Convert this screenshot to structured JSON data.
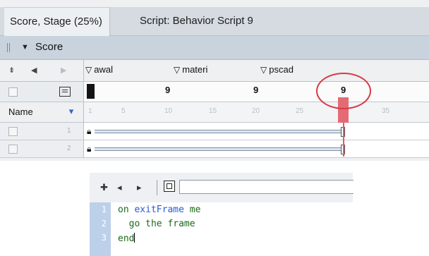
{
  "tabs": [
    {
      "label": "Score, Stage (25%)"
    },
    {
      "label": "Script: Behavior Script 9"
    }
  ],
  "score_panel": {
    "title": "Score",
    "markers": [
      {
        "label": "awal"
      },
      {
        "label": "materi"
      },
      {
        "label": "pscad"
      }
    ],
    "script_channel_numbers": [
      "9",
      "9",
      "9"
    ],
    "name_column_label": "Name",
    "ruler_ticks": [
      "1",
      "5",
      "10",
      "15",
      "20",
      "25",
      "35"
    ],
    "sprite_rows": [
      {
        "number": "1"
      },
      {
        "number": "2"
      }
    ]
  },
  "script_editor": {
    "line_numbers": [
      "1",
      "2",
      "3"
    ],
    "lines": [
      {
        "keyword": "on ",
        "identifier": "exitFrame",
        "rest": " me"
      },
      {
        "keyword": "  go the frame",
        "identifier": "",
        "rest": ""
      },
      {
        "keyword": "end",
        "identifier": "",
        "rest": ""
      }
    ]
  },
  "colors": {
    "tab_bar": "#d6dbe1",
    "panel_title_bg": "#c9d3de",
    "playhead": "#e46b74",
    "annotation_circle": "#d73a47",
    "gutter": "#bcd0ea",
    "keyword_green": "#1b6a1b"
  }
}
